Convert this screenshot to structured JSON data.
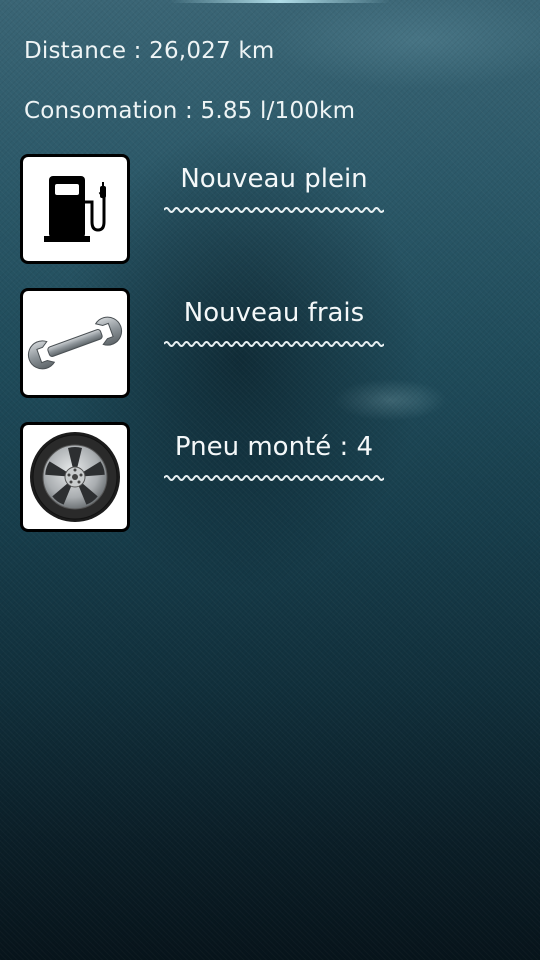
{
  "stats": {
    "distance": "Distance : 26,027 km",
    "consumption": "Consomation : 5.85 l/100km"
  },
  "actions": [
    {
      "label": "Nouveau plein",
      "icon": "fuel-pump-icon"
    },
    {
      "label": "Nouveau frais",
      "icon": "wrench-icon"
    },
    {
      "label": "Pneu monté : 4",
      "icon": "tire-wheel-icon"
    }
  ],
  "colors": {
    "background_top": "#3a6575",
    "background_bottom": "#07141b",
    "text": "#f2f6f7",
    "icon_frame": "#000000",
    "icon_background": "#ffffff"
  }
}
